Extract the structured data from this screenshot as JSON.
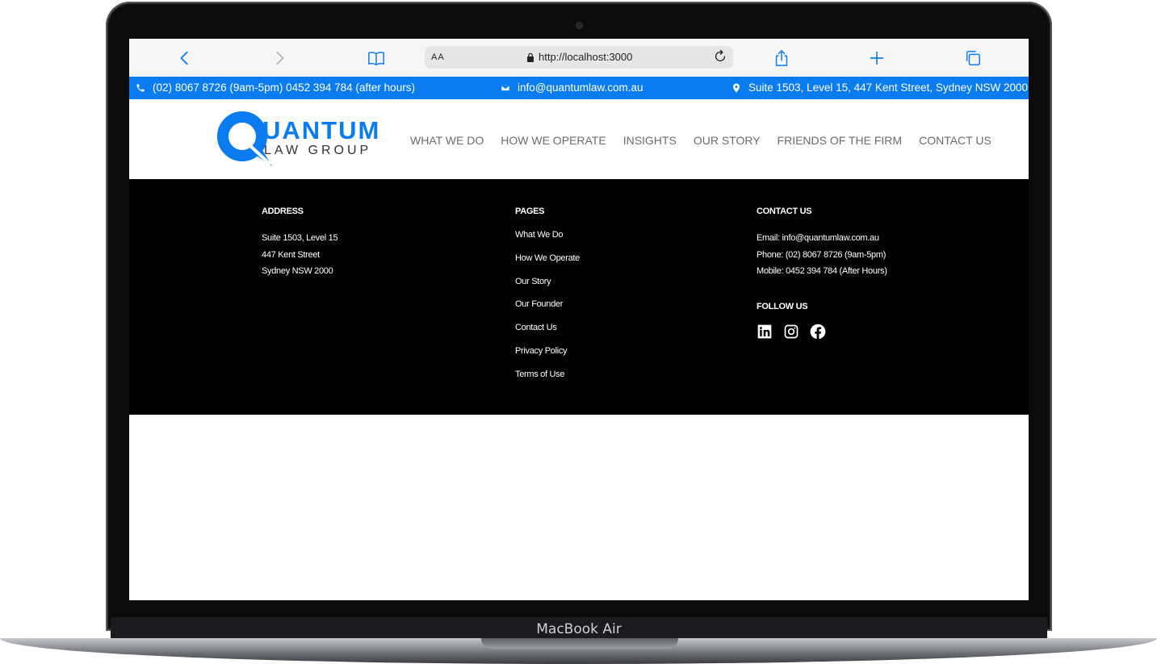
{
  "device": {
    "label": "MacBook Air"
  },
  "browser": {
    "aa_label": "AA",
    "url": "http://localhost:3000",
    "icons": [
      "back-chevron-icon",
      "forward-chevron-icon",
      "bookmarks-book-icon",
      "lock-icon",
      "reload-icon",
      "share-icon",
      "plus-icon",
      "tabs-icon"
    ]
  },
  "infobar": {
    "phone": "(02) 8067 8726 (9am-5pm) 0452 394 784 (after hours)",
    "email": "info@quantumlaw.com.au",
    "address": "Suite 1503, Level 15, 447 Kent Street, Sydney NSW 2000",
    "bg_color": "#0a7cf0"
  },
  "header": {
    "logo_main": "UANTUM",
    "logo_sub": "LAW GROUP",
    "nav": [
      "WHAT WE DO",
      "HOW WE OPERATE",
      "INSIGHTS",
      "OUR STORY",
      "FRIENDS OF THE FIRM",
      "CONTACT US"
    ]
  },
  "footer": {
    "address": {
      "heading": "ADDRESS",
      "lines": [
        "Suite 1503, Level 15",
        "447 Kent Street",
        "Sydney NSW 2000"
      ]
    },
    "pages": {
      "heading": "PAGES",
      "links": [
        "What We Do",
        "How We Operate",
        "Our Story",
        "Our Founder",
        "Contact Us",
        "Privacy Policy",
        "Terms of Use"
      ]
    },
    "contact": {
      "heading": "CONTACT US",
      "lines": [
        "Email: info@quantumlaw.com.au",
        "Phone: (02) 8067 8726 (9am-5pm)",
        "Mobile: 0452 394 784 (After Hours)"
      ],
      "follow_heading": "FOLLOW US",
      "social_icons": [
        "linkedin-icon",
        "instagram-icon",
        "facebook-icon"
      ]
    }
  }
}
